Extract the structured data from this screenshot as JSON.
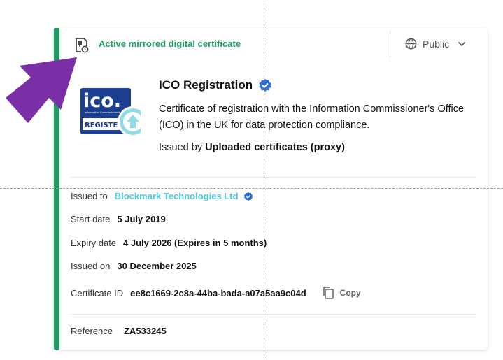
{
  "certificate": {
    "status_text": "Active mirrored digital certificate",
    "visibility_label": "Public",
    "title": "ICO Registration",
    "description": "Certificate of registration with the Information Commissioner's Office (ICO) in the UK for data protection compliance.",
    "issued_by_label": "Issued by",
    "issued_by_value": "Uploaded certificates (proxy)",
    "logo": {
      "text_main": "ico.",
      "text_small": "Information Commissioner's Office",
      "text_registered": "REGISTERED"
    }
  },
  "details": {
    "issued_to_label": "Issued to",
    "issued_to_value": "Blockmark Technologies Ltd",
    "start_date_label": "Start date",
    "start_date_value": "5 July 2019",
    "expiry_date_label": "Expiry date",
    "expiry_date_value": "4 July 2026 (Expires in 5 months)",
    "issued_on_label": "Issued on",
    "issued_on_value": "30 December 2025",
    "certificate_id_label": "Certificate ID",
    "certificate_id_value": "ee8c1669-2c8a-44ba-bada-a07a5aa9c04d",
    "copy_label": "Copy",
    "reference_label": "Reference",
    "reference_value": "ZA533245"
  },
  "colors": {
    "accent_green": "#1a9c62",
    "link_cyan": "#4ec8e0",
    "verified_blue": "#2f6fe0",
    "arrow_purple": "#7a2fa6",
    "ico_navy": "#1c3f8f"
  },
  "icons": [
    "certificate-status-icon",
    "globe-icon",
    "chevron-down-icon",
    "verified-badge-icon",
    "copy-icon",
    "upload-badge-icon",
    "pointer-arrow-icon"
  ]
}
